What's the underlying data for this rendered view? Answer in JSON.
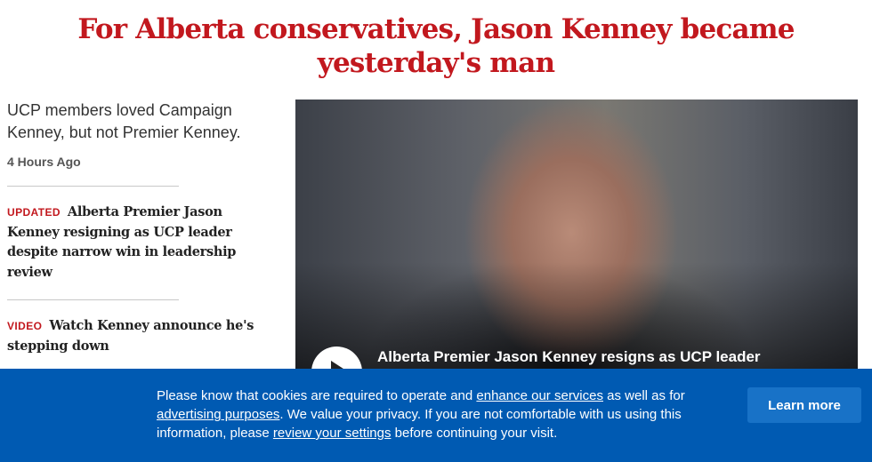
{
  "article": {
    "headline": "For Alberta conservatives, Jason Kenney became yesterday's man",
    "deck": "UCP members loved Campaign Kenney, but not Premier Kenney.",
    "timestamp": "4 Hours Ago"
  },
  "related_stories": [
    {
      "label": "UPDATED",
      "title": "Alberta Premier Jason Kenney resigning as UCP leader despite narrow win in leadership review"
    },
    {
      "label": "VIDEO",
      "title": "Watch Kenney announce he's stepping down"
    }
  ],
  "video": {
    "caption": "Alberta Premier Jason Kenney resigns as UCP leader",
    "play_icon": "play-icon"
  },
  "cookie_banner": {
    "text_1": "Please know that cookies are required to operate and ",
    "link_1": "enhance our services",
    "text_2": " as well as for ",
    "link_2": "advertising purposes",
    "text_3": ". We value your privacy. If you are not comfortable with us using this information, please ",
    "link_3": "review your settings",
    "text_4": " before continuing your visit.",
    "button": "Learn more"
  },
  "colors": {
    "accent_red": "#c2181e",
    "banner_blue": "#005ab2",
    "button_blue": "#1872c7"
  }
}
